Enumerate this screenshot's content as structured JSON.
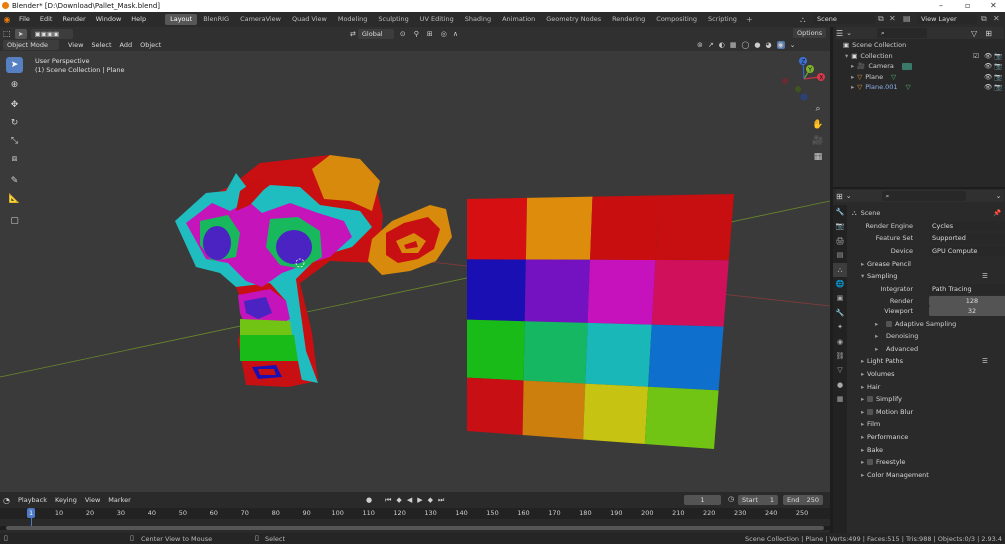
{
  "window": {
    "title": "Blender* [D:\\Download\\Pallet_Mask.blend]"
  },
  "menu": [
    "File",
    "Edit",
    "Render",
    "Window",
    "Help"
  ],
  "workspaces": [
    "Layout",
    "BlenRIG",
    "CameraView",
    "Quad View",
    "Modeling",
    "Sculpting",
    "UV Editing",
    "Shading",
    "Animation",
    "Geometry Nodes",
    "Rendering",
    "Compositing",
    "Scripting"
  ],
  "active_workspace": "Layout",
  "scene_name": "Scene",
  "view_layer": "View Layer",
  "vp_header": {
    "mode": "Object Mode",
    "menus": [
      "View",
      "Select",
      "Add",
      "Object"
    ],
    "orientation": "Global",
    "options": "Options"
  },
  "viewport": {
    "persp": "User Perspective",
    "collection": "(1) Scene Collection | Plane"
  },
  "gizmo": {
    "x": "X",
    "y": "Y",
    "z": "Z"
  },
  "outliner": {
    "root": "Scene Collection",
    "items": [
      {
        "name": "Collection"
      },
      {
        "name": "Camera"
      },
      {
        "name": "Plane"
      },
      {
        "name": "Plane.001"
      }
    ]
  },
  "props": {
    "scene": "Scene",
    "render_engine_label": "Render Engine",
    "render_engine": "Cycles",
    "feature_set_label": "Feature Set",
    "feature_set": "Supported",
    "device_label": "Device",
    "device": "GPU Compute",
    "grease_pencil": "Grease Pencil",
    "sampling": "Sampling",
    "integrator_label": "Integrator",
    "integrator": "Path Tracing",
    "render_label": "Render",
    "render_val": "128",
    "viewport_label": "Viewport",
    "viewport_val": "32",
    "adaptive": "Adaptive Sampling",
    "denoising": "Denoising",
    "advanced": "Advanced",
    "light_paths": "Light Paths",
    "volumes": "Volumes",
    "hair": "Hair",
    "simplify": "Simplify",
    "motion_blur": "Motion Blur",
    "film": "Film",
    "performance": "Performance",
    "bake": "Bake",
    "freestyle": "Freestyle",
    "color_mgmt": "Color Management"
  },
  "timeline": {
    "menus": [
      "Playback",
      "Keying",
      "View",
      "Marker"
    ],
    "current": "1",
    "start_label": "Start",
    "start": "1",
    "end_label": "End",
    "end": "250",
    "ticks": [
      "1",
      "10",
      "20",
      "30",
      "40",
      "50",
      "60",
      "70",
      "80",
      "90",
      "100",
      "110",
      "120",
      "130",
      "140",
      "150",
      "160",
      "170",
      "180",
      "190",
      "200",
      "210",
      "220",
      "230",
      "240",
      "250"
    ]
  },
  "status": {
    "center": "Center View to Mouse",
    "select": "Select",
    "stats": "Scene Collection | Plane | Verts:499 | Faces:515 | Tris:988 | Objects:0/3 | 2.93.4"
  },
  "palette": {
    "grid_rows": [
      [
        "#d60f12",
        "#dd8c0c",
        "#c90e10",
        "#c70e10"
      ],
      [
        "#1a0fb3",
        "#7412c2",
        "#c612bd",
        "#d0105a"
      ],
      [
        "#18bb18",
        "#16b763",
        "#19b7b7",
        "#0e6fcd"
      ],
      [
        "#c80f14",
        "#cd7f0e",
        "#c6c313",
        "#72c414"
      ]
    ]
  }
}
